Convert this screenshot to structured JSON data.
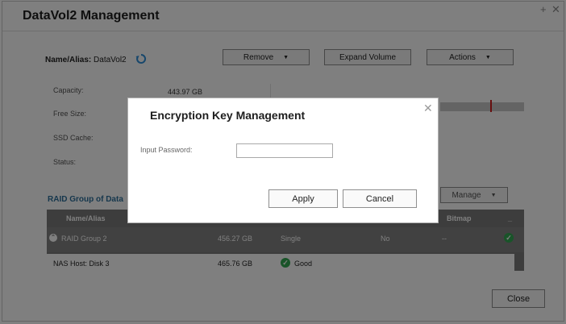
{
  "window": {
    "title": "DataVol2 Management",
    "controls": {
      "maximize": "+",
      "close": "✕"
    },
    "close_label": "Close"
  },
  "volume": {
    "name_label": "Name/Alias:",
    "name_value": "DataVol2",
    "refresh_icon": "refresh-icon"
  },
  "toolbar": {
    "remove_label": "Remove",
    "expand_label": "Expand Volume",
    "actions_label": "Actions"
  },
  "details": {
    "capacity_label": "Capacity:",
    "capacity_value": "443.97 GB",
    "free_label": "Free Size:",
    "ssd_label": "SSD Cache:",
    "status_label": "Status:",
    "usage_fraction": 0.6
  },
  "raid": {
    "section_label": "RAID Group of Data",
    "manage_label": "Manage",
    "columns": [
      "Name/Alias",
      "Bitmap",
      "_"
    ],
    "rows": [
      {
        "name": "RAID Group 2",
        "size": "456.27 GB",
        "type": "Single",
        "bitmap_flag": "No",
        "bitmap": "--",
        "status_icon": "check-icon"
      },
      {
        "name": "NAS Host: Disk 3",
        "size": "465.76 GB",
        "status": "Good",
        "status_icon": "check-icon"
      }
    ]
  },
  "dialog": {
    "title": "Encryption Key Management",
    "password_label": "Input Password:",
    "password_value": "",
    "apply_label": "Apply",
    "cancel_label": "Cancel",
    "close_glyph": "✕"
  },
  "colors": {
    "section_accent": "#2d6f9a",
    "usage_mark": "#d11f1f",
    "good_status": "#32a852"
  }
}
